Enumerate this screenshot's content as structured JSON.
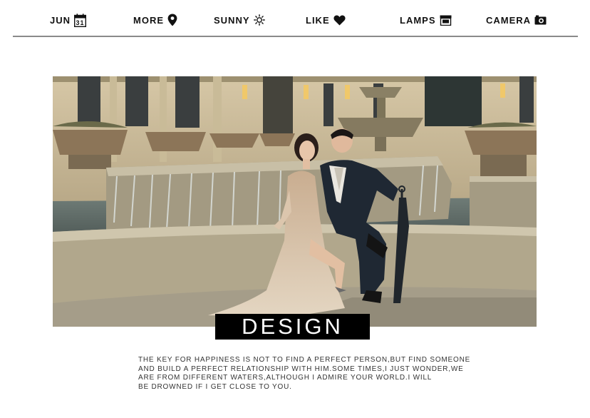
{
  "nav": {
    "items": [
      {
        "label": "JUN",
        "icon": "calendar-icon",
        "icon_text": "31"
      },
      {
        "label": "MORE",
        "icon": "location-pin-icon"
      },
      {
        "label": "SUNNY",
        "icon": "sun-icon"
      },
      {
        "label": "LIKE",
        "icon": "heart-icon"
      },
      {
        "label": "LAMPS",
        "icon": "shop-icon"
      },
      {
        "label": "CAMERA",
        "icon": "camera-icon"
      }
    ]
  },
  "hero": {
    "badge_text": "DESIGN"
  },
  "quote": {
    "text": "THE KEY FOR HAPPINESS IS NOT TO FIND A PERFECT PERSON,BUT FIND SOMEONE\nAND BUILD A PERFECT RELATIONSHIP WITH HIM.SOME TIMES,I JUST WONDER,WE\nARE FROM DIFFERENT WATERS,ALTHOUGH I ADMIRE YOUR WORLD.I WILL\nBE DROWNED IF I GET CLOSE TO YOU."
  }
}
